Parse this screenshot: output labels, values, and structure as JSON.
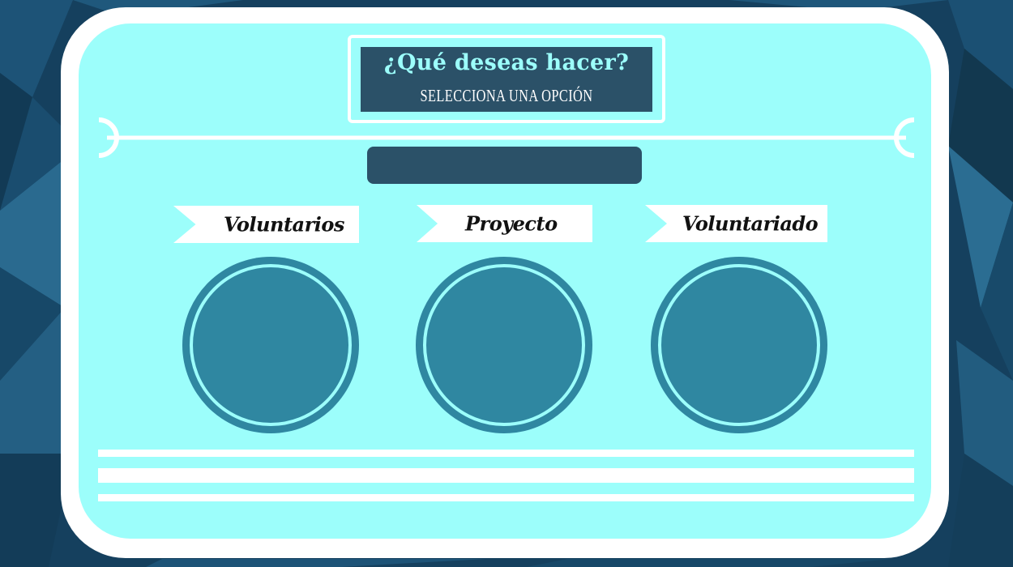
{
  "header": {
    "title": "¿Qué deseas hacer?",
    "subtitle": "SELECCIONA UNA OPCIÓN"
  },
  "options": [
    {
      "label": "Voluntarios"
    },
    {
      "label": "Proyecto"
    },
    {
      "label": "Voluntariado"
    }
  ],
  "colors": {
    "background": "#15405e",
    "panel": "#9cfefb",
    "frame": "#ffffff",
    "dark": "#2b5168",
    "circle": "#2f87a1"
  }
}
